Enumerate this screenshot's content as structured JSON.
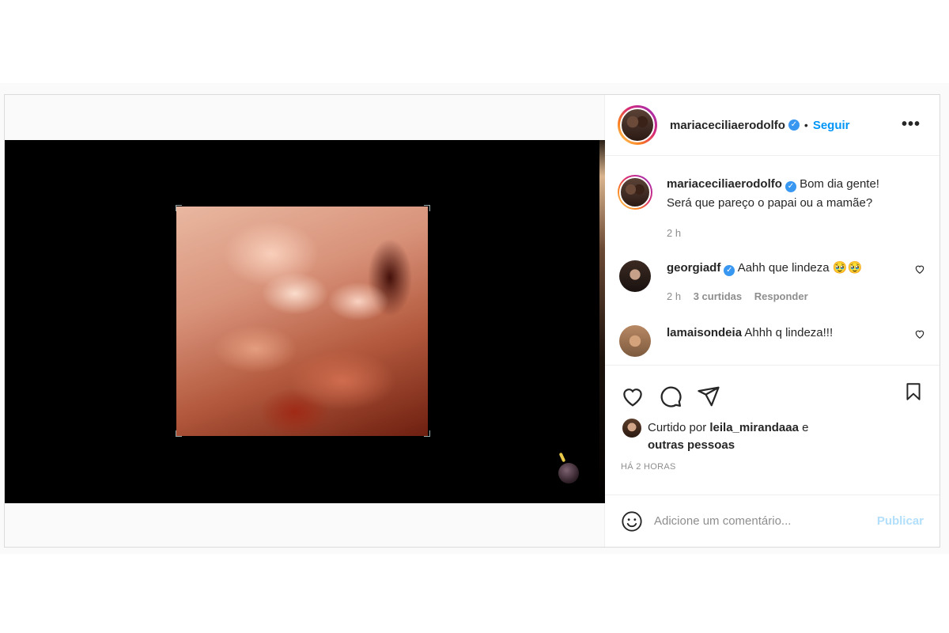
{
  "post": {
    "author": "mariaceciliaerodolfo",
    "follow_label": "Seguir",
    "separator": "•",
    "more_label": "•••",
    "caption_line1": "Bom dia gente!",
    "caption_line2": "Será que pareço o papai ou a mamãe?",
    "caption_time": "2 h",
    "timestamp": "HÁ 2 HORAS"
  },
  "comments": [
    {
      "user": "georgiadf",
      "text": "Aahh que lindeza 🥹🥹",
      "time": "2 h",
      "likes": "3 curtidas",
      "reply": "Responder"
    },
    {
      "user": "lamaisondeia",
      "text": "Ahhh q lindeza!!!"
    }
  ],
  "likes": {
    "prefix": "Curtido por",
    "user": "leila_mirandaaa",
    "suffix": "e",
    "line2": "outras pessoas"
  },
  "add_comment": {
    "placeholder": "Adicione um comentário...",
    "publish_label": "Publicar"
  },
  "icons": {
    "verified": "verified-badge-icon",
    "like": "heart-icon",
    "comment": "comment-bubble-icon",
    "share": "paper-plane-icon",
    "save": "bookmark-icon",
    "emoji": "smiley-icon"
  },
  "colors": {
    "accent": "#0095f6",
    "verified": "#3897f0",
    "muted": "#8e8e8e",
    "publish_disabled": "#b2dffc"
  }
}
